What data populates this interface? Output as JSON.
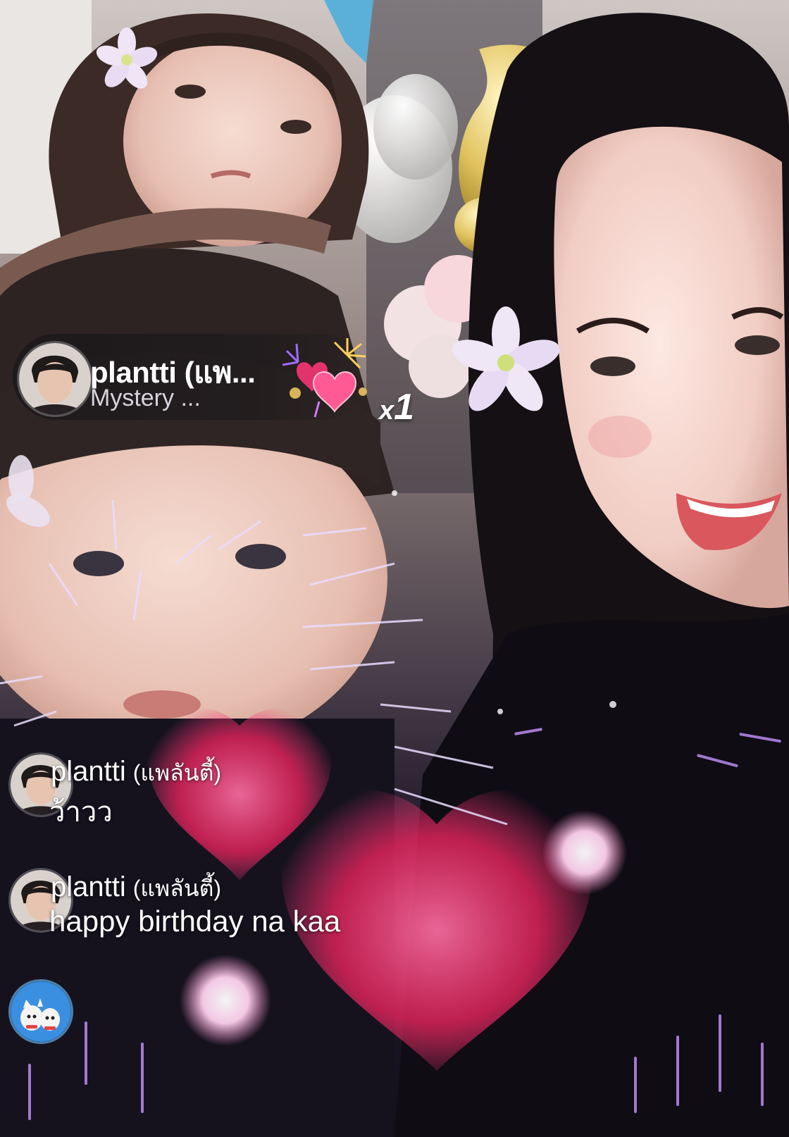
{
  "gift_banner": {
    "username": "plantti  (แพ...",
    "gift_name": "Mystery ...",
    "gift_icon": "heart-fireworks-icon",
    "combo_prefix": "x",
    "combo_count": "1"
  },
  "comments": [
    {
      "username": "plantti",
      "nickname": "(แพลันตี้)",
      "text": "ว้าวว"
    },
    {
      "username": "plantti",
      "nickname": "(แพลันตี้)",
      "text": "happy birthday na kaa"
    }
  ],
  "colors": {
    "banner_bg": "#141418",
    "text": "#ffffff",
    "firework_pink": "#ff3d7f",
    "firework_violet": "#b57cff"
  }
}
